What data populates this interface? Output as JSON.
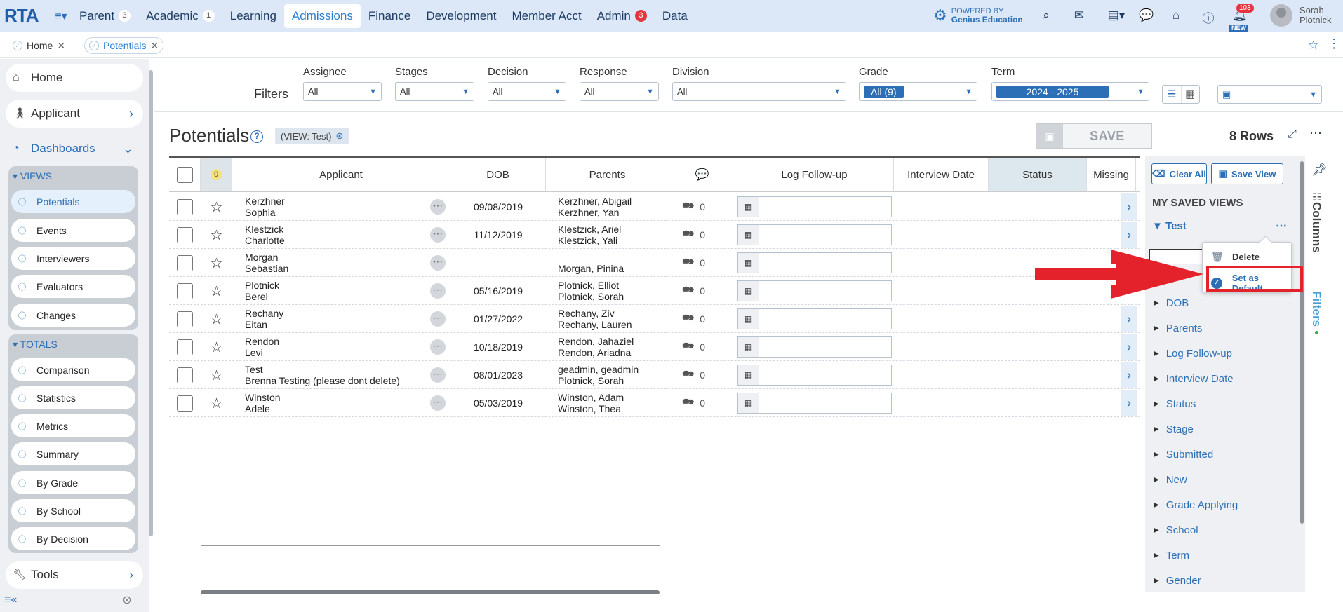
{
  "topnav": {
    "logo_r": "R",
    "logo_ta": "TA",
    "items": [
      {
        "label": "Parent",
        "badge": "3",
        "active": false
      },
      {
        "label": "Academic",
        "badge": "1",
        "active": false
      },
      {
        "label": "Learning",
        "badge": "",
        "active": false
      },
      {
        "label": "Admissions",
        "badge": "",
        "active": true
      },
      {
        "label": "Finance",
        "badge": "",
        "active": false
      },
      {
        "label": "Development",
        "badge": "",
        "active": false
      },
      {
        "label": "Member Acct",
        "badge": "",
        "active": false
      },
      {
        "label": "Admin",
        "badge": "3",
        "active": false
      },
      {
        "label": "Data",
        "badge": "",
        "active": false
      }
    ],
    "powered_line1": "POWERED BY",
    "powered_line2": "Genius Education",
    "notif_count": "103",
    "new_label": "NEW",
    "user_first": "Sorah",
    "user_last": "Plotnick"
  },
  "tabs": {
    "home": "Home",
    "potentials": "Potentials"
  },
  "sidebar": {
    "home": "Home",
    "applicant": "Applicant",
    "dashboards": "Dashboards",
    "views_label": "VIEWS",
    "views": [
      "Potentials",
      "Events",
      "Interviewers",
      "Evaluators",
      "Changes"
    ],
    "totals_label": "TOTALS",
    "totals": [
      "Comparison",
      "Statistics",
      "Metrics",
      "Summary",
      "By Grade",
      "By School",
      "By Decision"
    ],
    "tools": "Tools"
  },
  "filters": {
    "label": "Filters",
    "assignee": {
      "label": "Assignee",
      "value": "All"
    },
    "stages": {
      "label": "Stages",
      "value": "All"
    },
    "decision": {
      "label": "Decision",
      "value": "All"
    },
    "response": {
      "label": "Response",
      "value": "All"
    },
    "division": {
      "label": "Division",
      "value": "All"
    },
    "grade": {
      "label": "Grade",
      "value": "All (9)"
    },
    "term": {
      "label": "Term",
      "value": "2024 - 2025"
    }
  },
  "page": {
    "title": "Potentials",
    "view_chip": "(VIEW: Test)",
    "save_label": "SAVE",
    "rows_count": "8 Rows"
  },
  "table": {
    "headers": {
      "zero_badge": "0",
      "applicant": "Applicant",
      "dob": "DOB",
      "parents": "Parents",
      "log_followup": "Log Follow-up",
      "interview_date": "Interview Date",
      "status": "Status",
      "missing": "Missing"
    },
    "rows": [
      {
        "last": "Kerzhner",
        "first": "Sophia",
        "dob": "09/08/2019",
        "parent1": "Kerzhner, Abigail",
        "parent2": "Kerzhner, Yan",
        "comments": "0"
      },
      {
        "last": "Klestzick",
        "first": "Charlotte",
        "dob": "11/12/2019",
        "parent1": "Klestzick, Ariel",
        "parent2": "Klestzick, Yali",
        "comments": "0"
      },
      {
        "last": "Morgan",
        "first": "Sebastian",
        "dob": "",
        "parent1": "",
        "parent2": "Morgan, Pinina",
        "comments": "0"
      },
      {
        "last": "Plotnick",
        "first": "Berel",
        "dob": "05/16/2019",
        "parent1": "Plotnick, Elliot",
        "parent2": "Plotnick, Sorah",
        "comments": "0"
      },
      {
        "last": "Rechany",
        "first": "Eitan",
        "dob": "01/27/2022",
        "parent1": "Rechany, Ziv",
        "parent2": "Rechany, Lauren",
        "comments": "0"
      },
      {
        "last": "Rendon",
        "first": "Levi",
        "dob": "10/18/2019",
        "parent1": "Rendon, Jahaziel",
        "parent2": "Rendon, Ariadna",
        "comments": "0"
      },
      {
        "last": "Test",
        "first": "Brenna Testing (please dont delete)",
        "dob": "08/01/2023",
        "parent1": "geadmin, geadmin",
        "parent2": "Plotnick, Sorah",
        "comments": "0"
      },
      {
        "last": "Winston",
        "first": "Adele",
        "dob": "05/03/2019",
        "parent1": "Winston, Adam",
        "parent2": "Winston, Thea",
        "comments": "0"
      }
    ]
  },
  "right_panel": {
    "clear_all": "Clear All",
    "save_view": "Save View",
    "my_saved_views": "MY SAVED VIEWS",
    "saved_view_name": "Test",
    "columns": [
      "DOB",
      "Parents",
      "Log Follow-up",
      "Interview Date",
      "Status",
      "Stage",
      "Submitted",
      "New",
      "Grade Applying",
      "School",
      "Term",
      "Gender"
    ],
    "vertical_columns": "Columns",
    "vertical_filters": "Filters"
  },
  "popup": {
    "delete": "Delete",
    "set_default": "Set as Default"
  },
  "colors": {
    "accent": "#2d6fb6",
    "highlight": "#e3222c",
    "nav_bg": "#dce8f7"
  }
}
